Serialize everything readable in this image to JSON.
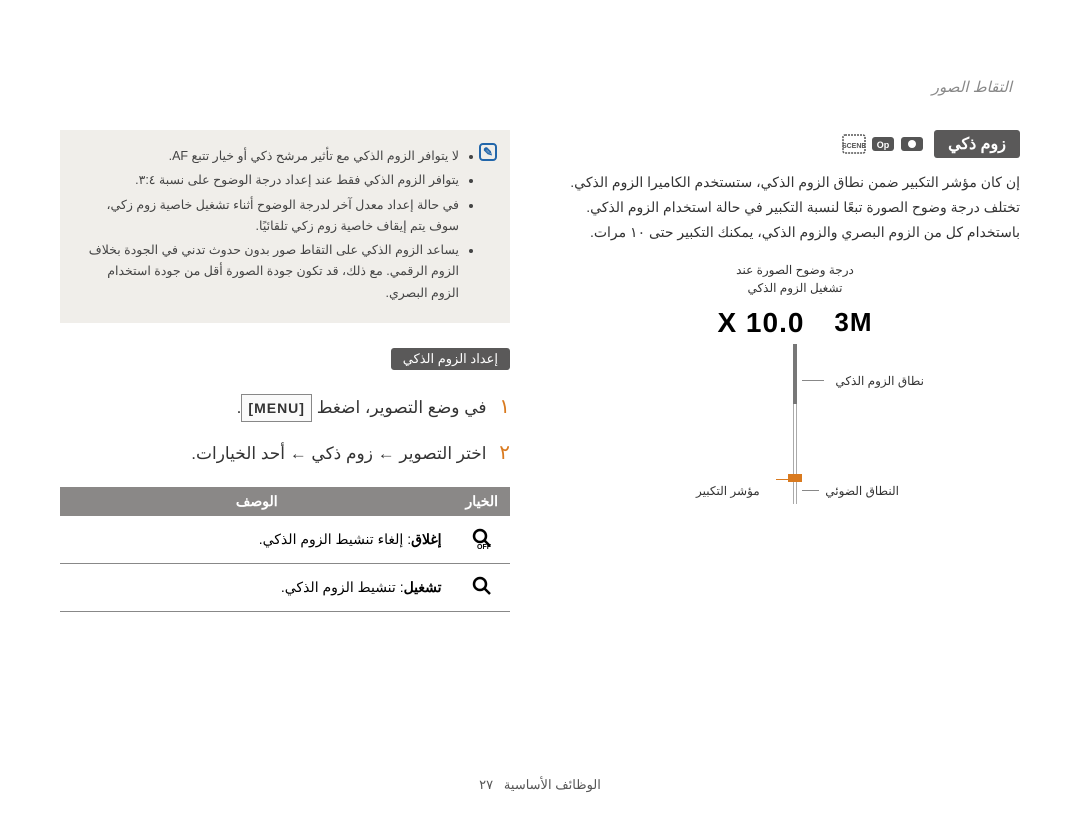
{
  "header": {
    "page_title": "التقاط الصور"
  },
  "section": {
    "title": "زوم ذكي",
    "intro": "إن كان مؤشر التكبير ضمن نطاق الزوم الذكي، ستستخدم الكاميرا الزوم الذكي. تختلف درجة وضوح الصورة تبعًا لنسبة التكبير في حالة استخدام الزوم الذكي. باستخدام كل من الزوم البصري والزوم الذكي، يمكنك التكبير حتى ١٠ مرات."
  },
  "diagram": {
    "caption": "درجة وضوح الصورة عند\nتشغيل الزوم الذكي",
    "zoom_badge": "3M",
    "zoom_value": "X 10.0",
    "label_smart": "نطاق الزوم الذكي",
    "label_optical": "النطاق الضوئي",
    "label_indicator": "مؤشر التكبير"
  },
  "notes": {
    "items": [
      "لا يتوافر الزوم الذكي مع تأثير مرشح ذكي أو خيار تتبع AF.",
      "يتوافر الزوم الذكي فقط عند إعداد درجة الوضوح على نسبة ٣:٤.",
      "في حالة إعداد معدل آخر لدرجة الوضوح أثناء تشغيل خاصية زوم زكي، سوف يتم إيقاف خاصية زوم زكي تلقائيًا.",
      "يساعد الزوم الذكي على التقاط صور بدون حدوث تدني في الجودة بخلاف الزوم الرقمي. مع ذلك، قد تكون جودة الصورة أقل من جودة استخدام الزوم البصري."
    ]
  },
  "setup": {
    "title": "إعداد الزوم الذكي",
    "step1_prefix": "في وضع التصوير، اضغط ",
    "step1_button": "MENU",
    "step1_suffix": ".",
    "step2": "اختر التصوير ← زوم ذكي ← أحد الخيارات."
  },
  "table": {
    "header_option": "الخيار",
    "header_desc": "الوصف",
    "row1_label": "إغلاق",
    "row1_desc": ": إلغاء تنشيط الزوم الذكي.",
    "row2_label": "تشغيل",
    "row2_desc": ": تنشيط الزوم الذكي."
  },
  "footer": {
    "label": "الوظائف الأساسية",
    "page_num": "٢٧"
  }
}
